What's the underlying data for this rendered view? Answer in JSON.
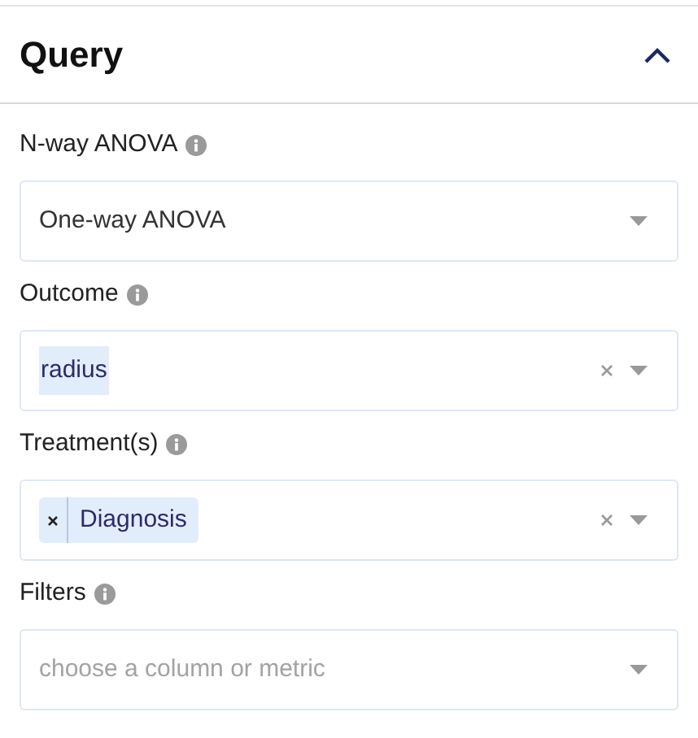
{
  "panel": {
    "title": "Query",
    "expanded": true
  },
  "fields": [
    {
      "label": "N-way ANOVA",
      "kind": "single",
      "value": "One-way ANOVA",
      "highlighted": false,
      "clearable": false
    },
    {
      "label": "Outcome",
      "kind": "single",
      "value": "radius",
      "highlighted": true,
      "clearable": true
    },
    {
      "label": "Treatment(s)",
      "kind": "multi",
      "tags": [
        "Diagnosis"
      ],
      "clearable": true
    },
    {
      "label": "Filters",
      "kind": "multi",
      "placeholder": "choose a column or metric",
      "clearable": false
    }
  ]
}
